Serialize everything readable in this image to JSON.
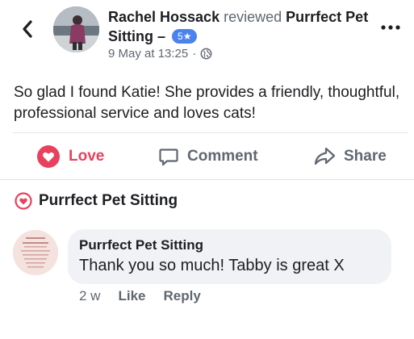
{
  "post": {
    "author": "Rachel Hossack",
    "verb": "reviewed",
    "page": "Purrfect Pet Sitting",
    "dash": "–",
    "rating": "5★",
    "timestamp": "9 May at 13:25",
    "separator": "·",
    "text": "So glad I found Katie! She provides a friendly, thoughtful, professional service and loves cats!"
  },
  "actions": {
    "love": "Love",
    "comment": "Comment",
    "share": "Share"
  },
  "reaction": {
    "name": "Purrfect Pet Sitting"
  },
  "comment": {
    "author": "Purrfect Pet Sitting",
    "text": "Thank you so much! Tabby is great X",
    "age": "2 w",
    "like": "Like",
    "reply": "Reply"
  },
  "colors": {
    "love_red": "#e8415e",
    "badge_blue": "#4a82ee",
    "muted_text": "#606770",
    "bubble_bg": "#f0f2f5"
  },
  "icons": [
    "back-arrow-icon",
    "globe-icon",
    "more-options-icon",
    "heart-icon",
    "comment-icon",
    "share-icon"
  ]
}
